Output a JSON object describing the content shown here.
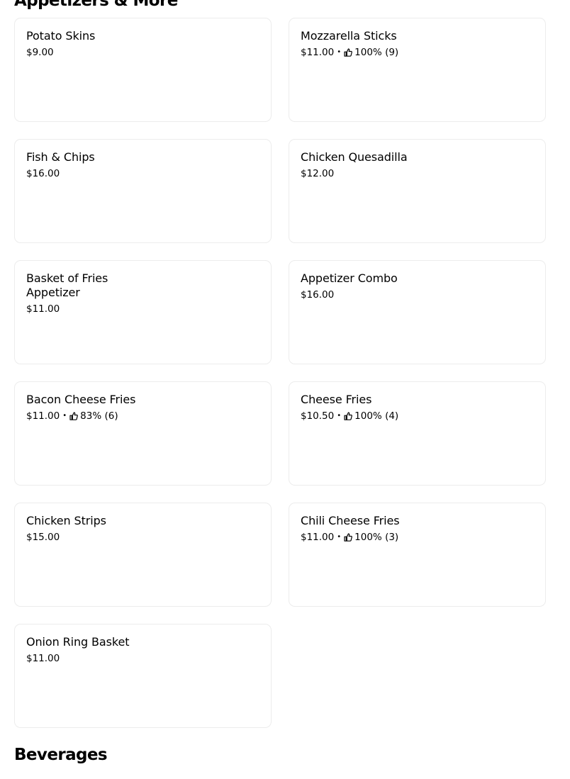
{
  "sections": {
    "top_heading": "Appetizers & More",
    "bottom_heading": "Beverages"
  },
  "items": [
    {
      "name": "Potato Skins",
      "price": "$9.00",
      "rating": null,
      "count": null
    },
    {
      "name": "Mozzarella Sticks",
      "price": "$11.00",
      "rating": "100%",
      "count": "(9)"
    },
    {
      "name": "Fish & Chips",
      "price": "$16.00",
      "rating": null,
      "count": null
    },
    {
      "name": "Chicken Quesadilla",
      "price": "$12.00",
      "rating": null,
      "count": null
    },
    {
      "name": "Basket of Fries Appetizer",
      "price": "$11.00",
      "rating": null,
      "count": null
    },
    {
      "name": "Appetizer Combo",
      "price": "$16.00",
      "rating": null,
      "count": null
    },
    {
      "name": "Bacon Cheese Fries",
      "price": "$11.00",
      "rating": "83%",
      "count": "(6)"
    },
    {
      "name": "Cheese Fries",
      "price": "$10.50",
      "rating": "100%",
      "count": "(4)"
    },
    {
      "name": "Chicken Strips",
      "price": "$15.00",
      "rating": null,
      "count": null
    },
    {
      "name": "Chili Cheese Fries",
      "price": "$11.00",
      "rating": "100%",
      "count": "(3)"
    },
    {
      "name": "Onion Ring Basket",
      "price": "$11.00",
      "rating": null,
      "count": null
    }
  ],
  "separator": "•",
  "icons": {
    "rating": "thumbs-up-icon"
  },
  "colors": {
    "text": "#000000",
    "card_border": "#ececec",
    "background": "#ffffff"
  }
}
